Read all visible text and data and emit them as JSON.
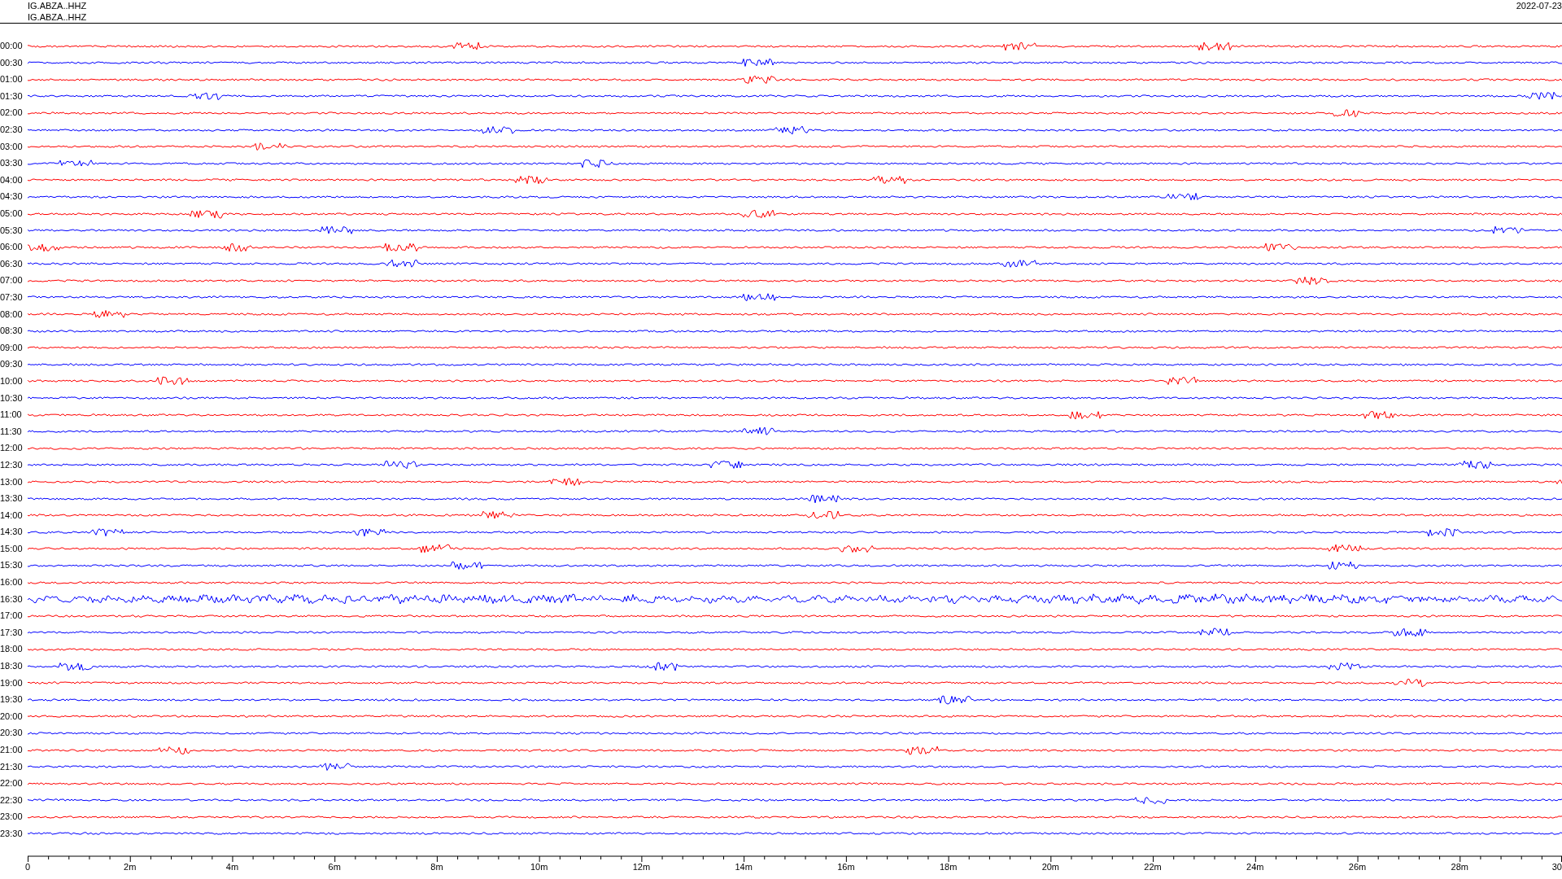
{
  "header": {
    "station_lines": [
      "IG.ABZA..HHZ",
      "IG.ABZA..HHZ"
    ],
    "date": "2022-07-23"
  },
  "traces": [
    {
      "time": "00:00",
      "color": "#ff0000"
    },
    {
      "time": "00:30",
      "color": "#0000ff"
    },
    {
      "time": "01:00",
      "color": "#ff0000"
    },
    {
      "time": "01:30",
      "color": "#0000ff"
    },
    {
      "time": "02:00",
      "color": "#ff0000"
    },
    {
      "time": "02:30",
      "color": "#0000ff"
    },
    {
      "time": "03:00",
      "color": "#ff0000"
    },
    {
      "time": "03:30",
      "color": "#0000ff"
    },
    {
      "time": "04:00",
      "color": "#ff0000"
    },
    {
      "time": "04:30",
      "color": "#0000ff"
    },
    {
      "time": "05:00",
      "color": "#ff0000"
    },
    {
      "time": "05:30",
      "color": "#0000ff"
    },
    {
      "time": "06:00",
      "color": "#ff0000"
    },
    {
      "time": "06:30",
      "color": "#0000ff"
    },
    {
      "time": "07:00",
      "color": "#ff0000"
    },
    {
      "time": "07:30",
      "color": "#0000ff"
    },
    {
      "time": "08:00",
      "color": "#ff0000"
    },
    {
      "time": "08:30",
      "color": "#0000ff"
    },
    {
      "time": "09:00",
      "color": "#ff0000"
    },
    {
      "time": "09:30",
      "color": "#0000ff"
    },
    {
      "time": "10:00",
      "color": "#ff0000"
    },
    {
      "time": "10:30",
      "color": "#0000ff"
    },
    {
      "time": "11:00",
      "color": "#ff0000"
    },
    {
      "time": "11:30",
      "color": "#0000ff"
    },
    {
      "time": "12:00",
      "color": "#ff0000"
    },
    {
      "time": "12:30",
      "color": "#0000ff"
    },
    {
      "time": "13:00",
      "color": "#ff0000"
    },
    {
      "time": "13:30",
      "color": "#0000ff"
    },
    {
      "time": "14:00",
      "color": "#ff0000"
    },
    {
      "time": "14:30",
      "color": "#0000ff"
    },
    {
      "time": "15:00",
      "color": "#ff0000"
    },
    {
      "time": "15:30",
      "color": "#0000ff"
    },
    {
      "time": "16:00",
      "color": "#ff0000"
    },
    {
      "time": "16:30",
      "color": "#0000ff"
    },
    {
      "time": "17:00",
      "color": "#ff0000"
    },
    {
      "time": "17:30",
      "color": "#0000ff"
    },
    {
      "time": "18:00",
      "color": "#ff0000"
    },
    {
      "time": "18:30",
      "color": "#0000ff"
    },
    {
      "time": "19:00",
      "color": "#ff0000"
    },
    {
      "time": "19:30",
      "color": "#0000ff"
    },
    {
      "time": "20:00",
      "color": "#ff0000"
    },
    {
      "time": "20:30",
      "color": "#0000ff"
    },
    {
      "time": "21:00",
      "color": "#ff0000"
    },
    {
      "time": "21:30",
      "color": "#0000ff"
    },
    {
      "time": "22:00",
      "color": "#ff0000"
    },
    {
      "time": "22:30",
      "color": "#0000ff"
    },
    {
      "time": "23:00",
      "color": "#ff0000"
    },
    {
      "time": "23:30",
      "color": "#0000ff"
    }
  ],
  "x_axis": {
    "ticks": [
      "0",
      "2m",
      "4m",
      "6m",
      "8m",
      "10m",
      "12m",
      "14m",
      "16m",
      "18m",
      "20m",
      "22m",
      "24m",
      "26m",
      "28m",
      "30"
    ]
  }
}
